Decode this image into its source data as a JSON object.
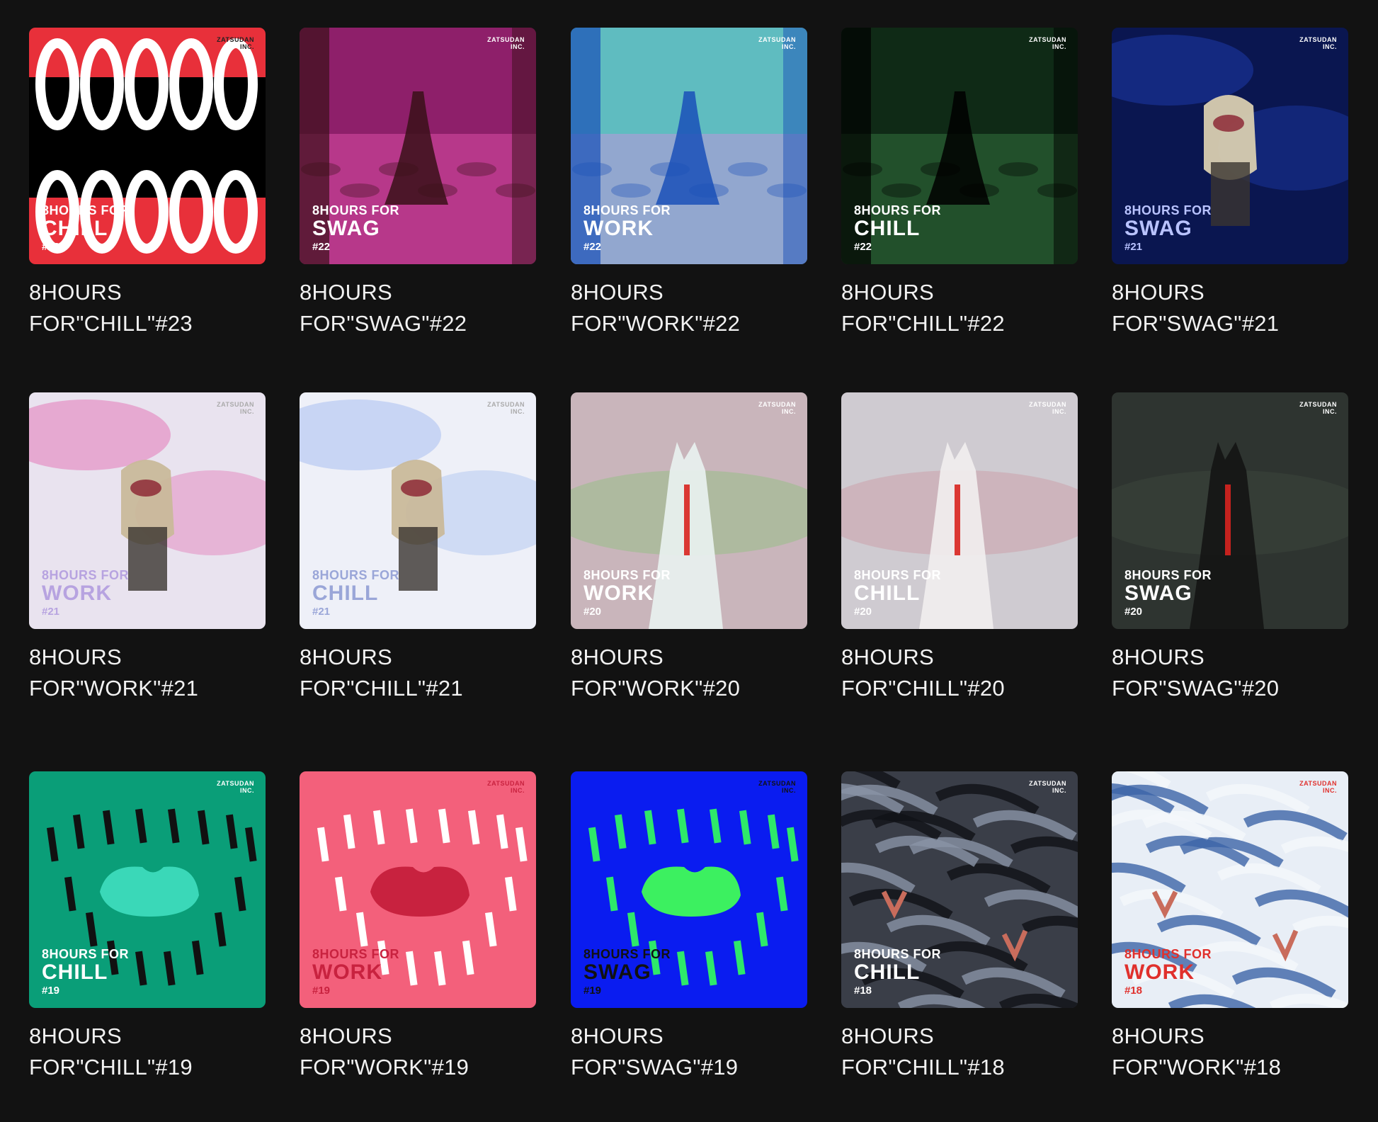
{
  "brand": [
    "ZATSUDAN",
    "INC."
  ],
  "albums": [
    {
      "cover_top": "8HOURS FOR",
      "cover_mood": "CHILL",
      "cover_number": "#23",
      "title_line1": "8HOURS",
      "title_line2": "FOR\"CHILL\"#23",
      "art": "teeth",
      "bg": "#e8303a",
      "accent": "#ffffff",
      "inner": "#000000",
      "text_color": "#ffffff",
      "brand_color": "#222222"
    },
    {
      "cover_top": "8HOURS FOR",
      "cover_mood": "SWAG",
      "cover_number": "#22",
      "title_line1": "8HOURS",
      "title_line2": "FOR\"SWAG\"#22",
      "art": "forest",
      "bg": "#8e1f6a",
      "accent": "#d24aa0",
      "inner": "#3a1018",
      "text_color": "#ffffff",
      "brand_color": "#ffffff"
    },
    {
      "cover_top": "8HOURS FOR",
      "cover_mood": "WORK",
      "cover_number": "#22",
      "title_line1": "8HOURS",
      "title_line2": "FOR\"WORK\"#22",
      "art": "forest",
      "bg": "#5fbcc0",
      "accent": "#b49ad8",
      "inner": "#1a50b8",
      "text_color": "#ffffff",
      "brand_color": "#ffffff"
    },
    {
      "cover_top": "8HOURS FOR",
      "cover_mood": "CHILL",
      "cover_number": "#22",
      "title_line1": "8HOURS",
      "title_line2": "FOR\"CHILL\"#22",
      "art": "forest",
      "bg": "#0f2a16",
      "accent": "#2f6a3a",
      "inner": "#000000",
      "text_color": "#ffffff",
      "brand_color": "#ffffff"
    },
    {
      "cover_top": "8HOURS FOR",
      "cover_mood": "SWAG",
      "cover_number": "#21",
      "title_line1": "8HOURS",
      "title_line2": "FOR\"SWAG\"#21",
      "art": "creature",
      "bg": "#0a1650",
      "accent": "#1d3aa8",
      "inner": "#d9cdb0",
      "text_color": "#b9c3ff",
      "brand_color": "#ffffff"
    },
    {
      "cover_top": "8HOURS FOR",
      "cover_mood": "WORK",
      "cover_number": "#21",
      "title_line1": "8HOURS",
      "title_line2": "FOR\"WORK\"#21",
      "art": "creature",
      "bg": "#e9e3ef",
      "accent": "#e37ab8",
      "inner": "#c9b99a",
      "text_color": "#b7a3e0",
      "brand_color": "#aaaaaa"
    },
    {
      "cover_top": "8HOURS FOR",
      "cover_mood": "CHILL",
      "cover_number": "#21",
      "title_line1": "8HOURS",
      "title_line2": "FOR\"CHILL\"#21",
      "art": "creature",
      "bg": "#eef0f8",
      "accent": "#a9c0f0",
      "inner": "#c9b99a",
      "text_color": "#9aa6d8",
      "brand_color": "#aaaaaa"
    },
    {
      "cover_top": "8HOURS FOR",
      "cover_mood": "WORK",
      "cover_number": "#20",
      "title_line1": "8HOURS",
      "title_line2": "FOR\"WORK\"#20",
      "art": "ghost",
      "bg": "#c9b5bb",
      "accent": "#8ec27e",
      "inner": "#e8f1ef",
      "text_color": "#ffffff",
      "brand_color": "#ffffff"
    },
    {
      "cover_top": "8HOURS FOR",
      "cover_mood": "CHILL",
      "cover_number": "#20",
      "title_line1": "8HOURS",
      "title_line2": "FOR\"CHILL\"#20",
      "art": "ghost",
      "bg": "#cfcbd1",
      "accent": "#c99aa2",
      "inner": "#f1eeee",
      "text_color": "#ffffff",
      "brand_color": "#ffffff"
    },
    {
      "cover_top": "8HOURS FOR",
      "cover_mood": "SWAG",
      "cover_number": "#20",
      "title_line1": "8HOURS",
      "title_line2": "FOR\"SWAG\"#20",
      "art": "ghost",
      "bg": "#2e3430",
      "accent": "#3e4a3e",
      "inner": "#151515",
      "text_color": "#ffffff",
      "brand_color": "#ffffff"
    },
    {
      "cover_top": "8HOURS FOR",
      "cover_mood": "CHILL",
      "cover_number": "#19",
      "title_line1": "8HOURS",
      "title_line2": "FOR\"CHILL\"#19",
      "art": "mouth",
      "bg": "#0a9e78",
      "accent": "#111111",
      "inner": "#3ad8b8",
      "text_color": "#ffffff",
      "brand_color": "#ffffff"
    },
    {
      "cover_top": "8HOURS FOR",
      "cover_mood": "WORK",
      "cover_number": "#19",
      "title_line1": "8HOURS",
      "title_line2": "FOR\"WORK\"#19",
      "art": "mouth",
      "bg": "#f3607b",
      "accent": "#ffffff",
      "inner": "#c8223f",
      "text_color": "#c8223f",
      "brand_color": "#c8223f"
    },
    {
      "cover_top": "8HOURS FOR",
      "cover_mood": "SWAG",
      "cover_number": "#19",
      "title_line1": "8HOURS",
      "title_line2": "FOR\"SWAG\"#19",
      "art": "mouth",
      "bg": "#0a1cf0",
      "accent": "#2ee86a",
      "inner": "#3cf060",
      "text_color": "#111111",
      "brand_color": "#111111"
    },
    {
      "cover_top": "8HOURS FOR",
      "cover_mood": "CHILL",
      "cover_number": "#18",
      "title_line1": "8HOURS",
      "title_line2": "FOR\"CHILL\"#18",
      "art": "fur",
      "bg": "#3a3e48",
      "accent": "#8a93a6",
      "inner": "#101216",
      "text_color": "#ffffff",
      "brand_color": "#ffffff"
    },
    {
      "cover_top": "8HOURS FOR",
      "cover_mood": "WORK",
      "cover_number": "#18",
      "title_line1": "8HOURS",
      "title_line2": "FOR\"WORK\"#18",
      "art": "fur",
      "bg": "#e8eef6",
      "accent": "#3c64a8",
      "inner": "#f4f7fb",
      "text_color": "#e0302c",
      "brand_color": "#e0302c"
    }
  ]
}
